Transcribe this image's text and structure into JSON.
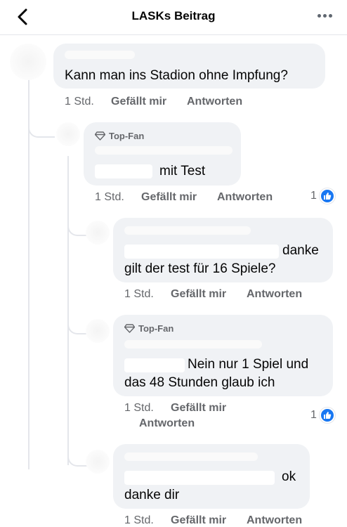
{
  "header": {
    "title": "LASKs Beitrag",
    "back_icon": "chevron-left-icon",
    "menu_icon": "more-horizontal-icon"
  },
  "colors": {
    "bubble": "#f0f2f5",
    "like": "#1877f2",
    "meta": "#65676b"
  },
  "comments": [
    {
      "text_lines": [
        "Kann man ins Stadion ohne Impfung?"
      ],
      "time": "1 Std.",
      "like": "Gefällt mir",
      "reply": "Antworten"
    },
    {
      "badge": "Top-Fan",
      "text_lines": [
        "mit Test"
      ],
      "time": "1 Std.",
      "like": "Gefällt mir",
      "reply": "Antworten",
      "reaction_count": "1"
    },
    {
      "text_lines": [
        "danke",
        "gilt der test für 16 Spiele?"
      ],
      "time": "1 Std.",
      "like": "Gefällt mir",
      "reply": "Antworten"
    },
    {
      "badge": "Top-Fan",
      "text_lines": [
        "Nein nur 1 Spiel und",
        "das 48 Stunden glaub ich"
      ],
      "time": "1 Std.",
      "like": "Gefällt mir",
      "reply": "Antworten",
      "reaction_count": "1"
    },
    {
      "text_lines": [
        "ok",
        "danke  dir"
      ],
      "time": "1 Std.",
      "like": "Gefällt mir",
      "reply": "Antworten"
    }
  ]
}
